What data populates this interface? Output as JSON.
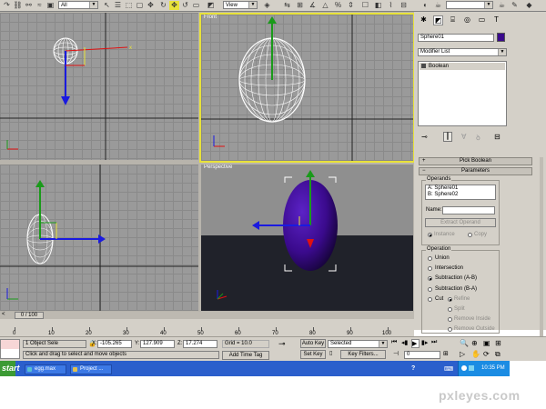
{
  "toolbar": {
    "filter_select": "All",
    "refcoord_select": "View"
  },
  "viewports": {
    "front_label": "Front",
    "perspective_label": "Perspective"
  },
  "command_panel": {
    "object_name": "Sphere01",
    "object_color": "#3a0a8c",
    "modifier_list": "Modifier List",
    "stack_item": "Boolean",
    "pick_boolean_rollout": "Pick Boolean",
    "parameters_rollout": "Parameters",
    "operands_group": "Operands",
    "operand_a": "A: Sphere01",
    "operand_b": "B: Sphere02",
    "name_label": "Name:",
    "extract_operand_button": "Extract Operand",
    "instance_label": "Instance",
    "copy_label": "Copy",
    "operation_group": "Operation",
    "operations": [
      "Union",
      "Intersection",
      "Subtraction (A-B)",
      "Subtraction (B-A)",
      "Cut"
    ],
    "refine_label": "Refine",
    "split_label": "Split",
    "remove_inside_label": "Remove Inside",
    "remove_outside_label": "Remove Outside"
  },
  "timeline": {
    "time_slider": "0 / 100",
    "ticks": [
      "0",
      "10",
      "20",
      "30",
      "40",
      "50",
      "60",
      "70",
      "80",
      "90",
      "100"
    ]
  },
  "status": {
    "selection_count": "1 Object Sele",
    "x_label": "X:",
    "x_value": "-105.265",
    "y_label": "Y:",
    "y_value": "127.909",
    "z_label": "Z:",
    "z_value": "17.274",
    "grid": "Grid = 10.0",
    "prompt": "Click and drag to select and move objects",
    "add_time_tag": "Add Time Tag",
    "auto_key": "Auto Key",
    "set_key": "Set Key",
    "key_mode_select": "Selected",
    "key_filters": "Key Filters...",
    "frame_value": "0"
  },
  "taskbar": {
    "start": "start",
    "tasks": [
      "egg.max",
      "Project ..."
    ],
    "clock": "10:35 PM"
  },
  "watermark": "pxleyes.com",
  "colors": {
    "accent_yellow": "#e8e23a",
    "egg_purple": "#3a0a8c",
    "axis_green": "#1a9a1a",
    "axis_blue": "#1a1ae0",
    "axis_red": "#e01010"
  }
}
